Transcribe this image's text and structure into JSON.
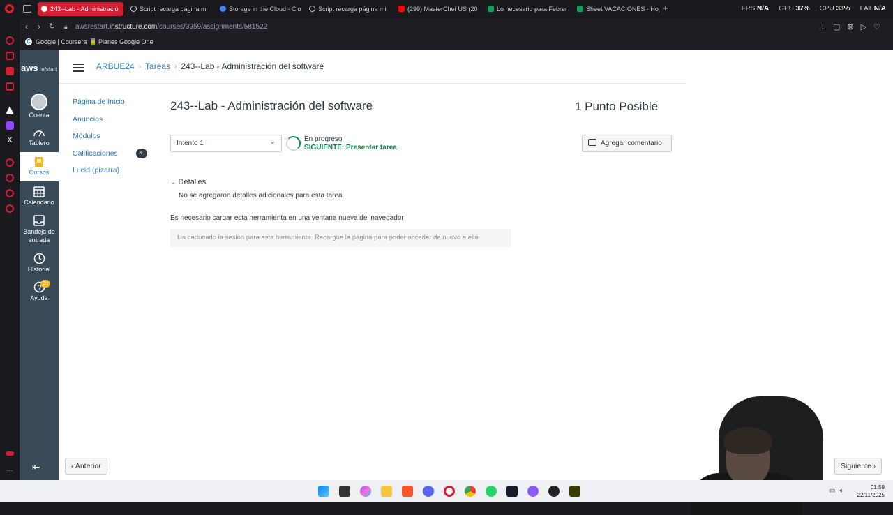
{
  "browser": {
    "tabs": [
      {
        "label": "243--Lab - Administració",
        "active": true,
        "color": "#ffffff"
      },
      {
        "label": "Script recarga página mi",
        "active": false,
        "color": "#cccccc"
      },
      {
        "label": "Storage in the Cloud - Clo",
        "active": false,
        "color": "#4285f4"
      },
      {
        "label": "Script recarga página mi",
        "active": false,
        "color": "#cccccc"
      },
      {
        "label": "(299) MasterChef US (20",
        "active": false,
        "color": "#ff0000"
      },
      {
        "label": "Lo necesario para Febrer",
        "active": false,
        "color": "#0f9d58"
      },
      {
        "label": "Sheet VACACIONES - Hoj",
        "active": false,
        "color": "#0f9d58"
      }
    ],
    "stats": {
      "fps_label": "FPS",
      "fps_value": "N/A",
      "gpu_label": "GPU",
      "gpu_value": "37%",
      "cpu_label": "CPU",
      "cpu_value": "33%",
      "lat_label": "LAT",
      "lat_value": "N/A"
    },
    "url_prefix": "awsrestart.",
    "url_host": "instructure.com",
    "url_path": "/courses/3959/assignments/581522",
    "bookmarks": [
      "Google | Coursera",
      "Planes Google One"
    ]
  },
  "global_nav": {
    "logo": "aws",
    "logo_sub": "re/start",
    "items": [
      {
        "label": "Cuenta",
        "icon": "avatar-icon"
      },
      {
        "label": "Tablero",
        "icon": "dashboard-icon"
      },
      {
        "label": "Cursos",
        "icon": "courses-icon",
        "active": true
      },
      {
        "label": "Calendario",
        "icon": "calendar-icon"
      },
      {
        "label": "Bandeja de entrada",
        "icon": "inbox-icon"
      },
      {
        "label": "Historial",
        "icon": "history-icon"
      },
      {
        "label": "Ayuda",
        "icon": "help-icon",
        "badge": "10"
      }
    ]
  },
  "breadcrumb": {
    "course": "ARBUE24",
    "section": "Tareas",
    "current": "243--Lab - Administración del software"
  },
  "course_nav": [
    {
      "label": "Página de Inicio"
    },
    {
      "label": "Anuncios"
    },
    {
      "label": "Módulos"
    },
    {
      "label": "Calificaciones",
      "badge": "30"
    },
    {
      "label": "Lucid (pizarra)"
    }
  ],
  "assignment": {
    "title": "243--Lab - Administración del software",
    "points": "1 Punto Posible",
    "attempt": "Intento 1",
    "status": "En progreso",
    "next_step": "SIGUIENTE: Presentar tarea",
    "comment_button": "Agregar comentario",
    "details_label": "Detalles",
    "details_text": "No se agregaron detalles adicionales para esta tarea.",
    "tool_note": "Es necesario cargar esta herramienta en una ventana nueva del navegador",
    "tool_message": "Ha caducado la sesión para esta herramienta. Recargue la página para poder acceder de nuevo a ella."
  },
  "pager": {
    "prev": "Anterior",
    "next": "Siguiente"
  },
  "taskbar": {
    "time": "01:59",
    "date": "22/11/2025"
  },
  "colors": {
    "accent": "#2b7abc",
    "nav_bg": "#394b58",
    "success": "#0b874b",
    "brand_red": "#d41e32"
  }
}
